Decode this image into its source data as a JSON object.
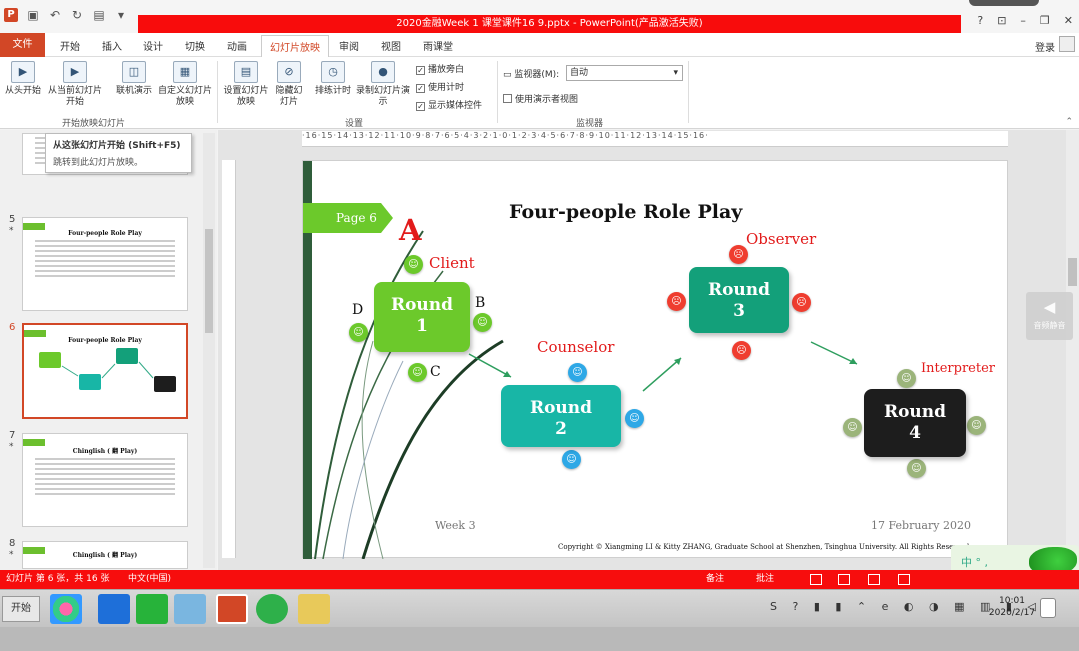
{
  "titlebar": {
    "title": "2020金融Week 1 课堂课件16 9.pptx - PowerPoint(产品激活失败)",
    "controls": [
      "?",
      "⊡",
      "–",
      "❐",
      "✕"
    ]
  },
  "tabs": {
    "file": "文件",
    "items": [
      "开始",
      "插入",
      "设计",
      "切换",
      "动画",
      "幻灯片放映",
      "审阅",
      "视图",
      "雨课堂"
    ],
    "active": "幻灯片放映",
    "login": "登录"
  },
  "ribbon": {
    "start_group": {
      "from_beginning": "从头开始",
      "from_current": "从当前幻灯片开始",
      "online": "联机演示",
      "custom": "自定义幻灯片放映",
      "label": "开始放映幻灯片"
    },
    "setup_group": {
      "setup": "设置幻灯片放映",
      "hide": "隐藏幻灯片",
      "rehearse": "排练计时",
      "record": "录制幻灯片演示",
      "chk_narration": "播放旁白",
      "chk_timings": "使用计时",
      "chk_media": "显示媒体控件",
      "label": "设置"
    },
    "monitor_group": {
      "monitor_label": "监视器(M):",
      "monitor_value": "自动",
      "presenter_view": "使用演示者视图",
      "label": "监视器"
    }
  },
  "tooltip": {
    "title": "从这张幻灯片开始 (Shift+F5)",
    "body": "跳转到此幻灯片放映。"
  },
  "thumbnails": [
    {
      "num": "5",
      "title": "Four-people Role Play",
      "star": "*"
    },
    {
      "num": "6",
      "title": "Four-people Role Play",
      "star": "*"
    },
    {
      "num": "7",
      "title": "Chinglish ( 翻 Play)",
      "star": "*"
    },
    {
      "num": "8",
      "title": "Chinglish ( 翻 Play)",
      "star": "*"
    }
  ],
  "ruler": "·16·15·14·13·12·11·10·9·8·7·6·5·4·3·2·1·0·1·2·3·4·5·6·7·8·9·10·11·12·13·14·15·16·",
  "slide": {
    "page_tag": "Page 6",
    "title": "Four-people Role Play",
    "letter_A": "A",
    "roles": {
      "client": "Client",
      "counselor": "Counselor",
      "observer": "Observer",
      "interpreter": "Interpreter"
    },
    "letters": {
      "b": "B",
      "c": "C",
      "d": "D"
    },
    "rounds": [
      {
        "label": "Round",
        "num": "1",
        "color": "#6cc92b"
      },
      {
        "label": "Round",
        "num": "2",
        "color": "#18b6a6"
      },
      {
        "label": "Round",
        "num": "3",
        "color": "#13a07a"
      },
      {
        "label": "Round",
        "num": "4",
        "color": "#1d1d1d"
      }
    ],
    "week": "Week 3",
    "date": "17 February 2020",
    "copyright": "Copyright © Xiangming LI & Kitty ZHANG, Graduate School at Shenzhen, Tsinghua University. All Rights Reserved."
  },
  "side_button": "音频静音",
  "ime": "中 ° ,",
  "status": {
    "slide_info": "幻灯片 第 6 张，共 16 张",
    "language": "中文(中国)",
    "notes": "备注",
    "comments": "批注"
  },
  "taskbar": {
    "start": "开始",
    "time": "10:01",
    "date": "2020/2/17"
  },
  "colors": {
    "accent": "#d24726",
    "status_red": "#f70d0d",
    "slide_green": "#6cc92b",
    "role_red": "#e21b1b"
  }
}
